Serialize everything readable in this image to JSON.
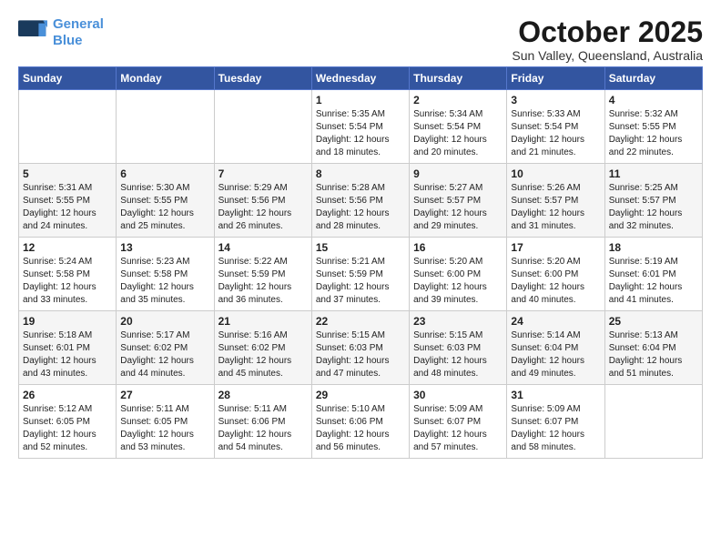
{
  "logo": {
    "line1": "General",
    "line2": "Blue"
  },
  "title": "October 2025",
  "subtitle": "Sun Valley, Queensland, Australia",
  "days_of_week": [
    "Sunday",
    "Monday",
    "Tuesday",
    "Wednesday",
    "Thursday",
    "Friday",
    "Saturday"
  ],
  "weeks": [
    [
      {
        "day": "",
        "sunrise": "",
        "sunset": "",
        "daylight": ""
      },
      {
        "day": "",
        "sunrise": "",
        "sunset": "",
        "daylight": ""
      },
      {
        "day": "",
        "sunrise": "",
        "sunset": "",
        "daylight": ""
      },
      {
        "day": "1",
        "sunrise": "Sunrise: 5:35 AM",
        "sunset": "Sunset: 5:54 PM",
        "daylight": "Daylight: 12 hours and 18 minutes."
      },
      {
        "day": "2",
        "sunrise": "Sunrise: 5:34 AM",
        "sunset": "Sunset: 5:54 PM",
        "daylight": "Daylight: 12 hours and 20 minutes."
      },
      {
        "day": "3",
        "sunrise": "Sunrise: 5:33 AM",
        "sunset": "Sunset: 5:54 PM",
        "daylight": "Daylight: 12 hours and 21 minutes."
      },
      {
        "day": "4",
        "sunrise": "Sunrise: 5:32 AM",
        "sunset": "Sunset: 5:55 PM",
        "daylight": "Daylight: 12 hours and 22 minutes."
      }
    ],
    [
      {
        "day": "5",
        "sunrise": "Sunrise: 5:31 AM",
        "sunset": "Sunset: 5:55 PM",
        "daylight": "Daylight: 12 hours and 24 minutes."
      },
      {
        "day": "6",
        "sunrise": "Sunrise: 5:30 AM",
        "sunset": "Sunset: 5:55 PM",
        "daylight": "Daylight: 12 hours and 25 minutes."
      },
      {
        "day": "7",
        "sunrise": "Sunrise: 5:29 AM",
        "sunset": "Sunset: 5:56 PM",
        "daylight": "Daylight: 12 hours and 26 minutes."
      },
      {
        "day": "8",
        "sunrise": "Sunrise: 5:28 AM",
        "sunset": "Sunset: 5:56 PM",
        "daylight": "Daylight: 12 hours and 28 minutes."
      },
      {
        "day": "9",
        "sunrise": "Sunrise: 5:27 AM",
        "sunset": "Sunset: 5:57 PM",
        "daylight": "Daylight: 12 hours and 29 minutes."
      },
      {
        "day": "10",
        "sunrise": "Sunrise: 5:26 AM",
        "sunset": "Sunset: 5:57 PM",
        "daylight": "Daylight: 12 hours and 31 minutes."
      },
      {
        "day": "11",
        "sunrise": "Sunrise: 5:25 AM",
        "sunset": "Sunset: 5:57 PM",
        "daylight": "Daylight: 12 hours and 32 minutes."
      }
    ],
    [
      {
        "day": "12",
        "sunrise": "Sunrise: 5:24 AM",
        "sunset": "Sunset: 5:58 PM",
        "daylight": "Daylight: 12 hours and 33 minutes."
      },
      {
        "day": "13",
        "sunrise": "Sunrise: 5:23 AM",
        "sunset": "Sunset: 5:58 PM",
        "daylight": "Daylight: 12 hours and 35 minutes."
      },
      {
        "day": "14",
        "sunrise": "Sunrise: 5:22 AM",
        "sunset": "Sunset: 5:59 PM",
        "daylight": "Daylight: 12 hours and 36 minutes."
      },
      {
        "day": "15",
        "sunrise": "Sunrise: 5:21 AM",
        "sunset": "Sunset: 5:59 PM",
        "daylight": "Daylight: 12 hours and 37 minutes."
      },
      {
        "day": "16",
        "sunrise": "Sunrise: 5:20 AM",
        "sunset": "Sunset: 6:00 PM",
        "daylight": "Daylight: 12 hours and 39 minutes."
      },
      {
        "day": "17",
        "sunrise": "Sunrise: 5:20 AM",
        "sunset": "Sunset: 6:00 PM",
        "daylight": "Daylight: 12 hours and 40 minutes."
      },
      {
        "day": "18",
        "sunrise": "Sunrise: 5:19 AM",
        "sunset": "Sunset: 6:01 PM",
        "daylight": "Daylight: 12 hours and 41 minutes."
      }
    ],
    [
      {
        "day": "19",
        "sunrise": "Sunrise: 5:18 AM",
        "sunset": "Sunset: 6:01 PM",
        "daylight": "Daylight: 12 hours and 43 minutes."
      },
      {
        "day": "20",
        "sunrise": "Sunrise: 5:17 AM",
        "sunset": "Sunset: 6:02 PM",
        "daylight": "Daylight: 12 hours and 44 minutes."
      },
      {
        "day": "21",
        "sunrise": "Sunrise: 5:16 AM",
        "sunset": "Sunset: 6:02 PM",
        "daylight": "Daylight: 12 hours and 45 minutes."
      },
      {
        "day": "22",
        "sunrise": "Sunrise: 5:15 AM",
        "sunset": "Sunset: 6:03 PM",
        "daylight": "Daylight: 12 hours and 47 minutes."
      },
      {
        "day": "23",
        "sunrise": "Sunrise: 5:15 AM",
        "sunset": "Sunset: 6:03 PM",
        "daylight": "Daylight: 12 hours and 48 minutes."
      },
      {
        "day": "24",
        "sunrise": "Sunrise: 5:14 AM",
        "sunset": "Sunset: 6:04 PM",
        "daylight": "Daylight: 12 hours and 49 minutes."
      },
      {
        "day": "25",
        "sunrise": "Sunrise: 5:13 AM",
        "sunset": "Sunset: 6:04 PM",
        "daylight": "Daylight: 12 hours and 51 minutes."
      }
    ],
    [
      {
        "day": "26",
        "sunrise": "Sunrise: 5:12 AM",
        "sunset": "Sunset: 6:05 PM",
        "daylight": "Daylight: 12 hours and 52 minutes."
      },
      {
        "day": "27",
        "sunrise": "Sunrise: 5:11 AM",
        "sunset": "Sunset: 6:05 PM",
        "daylight": "Daylight: 12 hours and 53 minutes."
      },
      {
        "day": "28",
        "sunrise": "Sunrise: 5:11 AM",
        "sunset": "Sunset: 6:06 PM",
        "daylight": "Daylight: 12 hours and 54 minutes."
      },
      {
        "day": "29",
        "sunrise": "Sunrise: 5:10 AM",
        "sunset": "Sunset: 6:06 PM",
        "daylight": "Daylight: 12 hours and 56 minutes."
      },
      {
        "day": "30",
        "sunrise": "Sunrise: 5:09 AM",
        "sunset": "Sunset: 6:07 PM",
        "daylight": "Daylight: 12 hours and 57 minutes."
      },
      {
        "day": "31",
        "sunrise": "Sunrise: 5:09 AM",
        "sunset": "Sunset: 6:07 PM",
        "daylight": "Daylight: 12 hours and 58 minutes."
      },
      {
        "day": "",
        "sunrise": "",
        "sunset": "",
        "daylight": ""
      }
    ]
  ]
}
